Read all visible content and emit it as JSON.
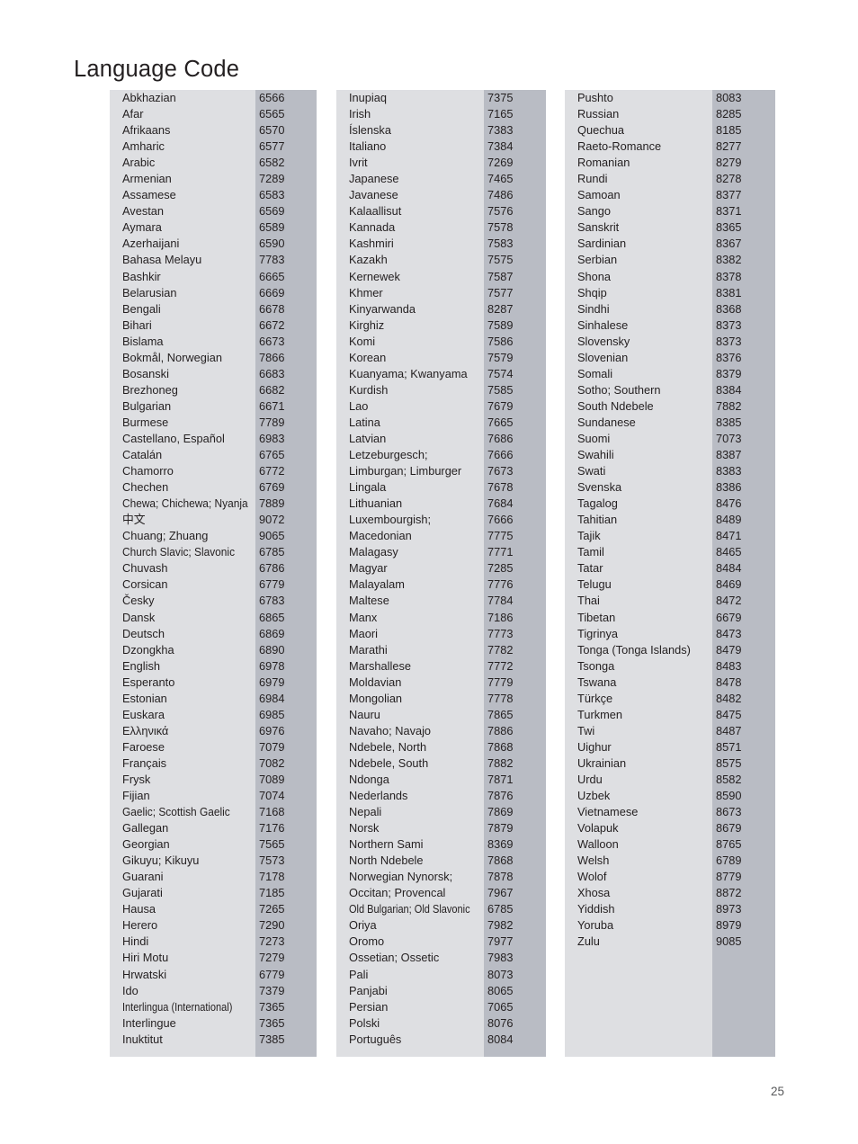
{
  "page": {
    "title": "Language Code",
    "page_number": "25",
    "colors": {
      "name_column_bg": "#dedfe2",
      "code_column_bg": "#b9bcc4",
      "text": "#231f20",
      "page_number_text": "#58595b",
      "background": "#ffffff"
    }
  },
  "columns": [
    {
      "id": "column-1",
      "rows": [
        {
          "name": "Abkhazian",
          "code": "6566"
        },
        {
          "name": "Afar",
          "code": "6565"
        },
        {
          "name": "Afrikaans",
          "code": "6570"
        },
        {
          "name": "Amharic",
          "code": "6577"
        },
        {
          "name": "Arabic",
          "code": "6582"
        },
        {
          "name": "Armenian",
          "code": "7289"
        },
        {
          "name": "Assamese",
          "code": "6583"
        },
        {
          "name": "Avestan",
          "code": "6569"
        },
        {
          "name": "Aymara",
          "code": "6589"
        },
        {
          "name": "Azerhaijani",
          "code": "6590"
        },
        {
          "name": "Bahasa Melayu",
          "code": "7783"
        },
        {
          "name": "Bashkir",
          "code": "6665"
        },
        {
          "name": "Belarusian",
          "code": "6669"
        },
        {
          "name": "Bengali",
          "code": "6678"
        },
        {
          "name": "Bihari",
          "code": "6672"
        },
        {
          "name": "Bislama",
          "code": "6673"
        },
        {
          "name": "Bokmål, Norwegian",
          "code": "7866"
        },
        {
          "name": "Bosanski",
          "code": "6683"
        },
        {
          "name": "Brezhoneg",
          "code": "6682"
        },
        {
          "name": "Bulgarian",
          "code": "6671"
        },
        {
          "name": "Burmese",
          "code": "7789"
        },
        {
          "name": "Castellano, Español",
          "code": "6983"
        },
        {
          "name": "Catalán",
          "code": "6765"
        },
        {
          "name": "Chamorro",
          "code": "6772"
        },
        {
          "name": "Chechen",
          "code": "6769"
        },
        {
          "name": "Chewa; Chichewa; Nyanja",
          "code": "7889"
        },
        {
          "name": "中文",
          "code": "9072"
        },
        {
          "name": "Chuang; Zhuang",
          "code": "9065"
        },
        {
          "name": "Church Slavic; Slavonic",
          "code": "6785"
        },
        {
          "name": "Chuvash",
          "code": "6786"
        },
        {
          "name": "Corsican",
          "code": "6779"
        },
        {
          "name": "Česky",
          "code": "6783"
        },
        {
          "name": "Dansk",
          "code": "6865"
        },
        {
          "name": "Deutsch",
          "code": "6869"
        },
        {
          "name": "Dzongkha",
          "code": "6890"
        },
        {
          "name": "English",
          "code": "6978"
        },
        {
          "name": "Esperanto",
          "code": "6979"
        },
        {
          "name": "Estonian",
          "code": "6984"
        },
        {
          "name": "Euskara",
          "code": "6985"
        },
        {
          "name": "Ελληνικά",
          "code": "6976"
        },
        {
          "name": "Faroese",
          "code": "7079"
        },
        {
          "name": "Français",
          "code": "7082"
        },
        {
          "name": "Frysk",
          "code": "7089"
        },
        {
          "name": "Fijian",
          "code": "7074"
        },
        {
          "name": "Gaelic; Scottish Gaelic",
          "code": "7168"
        },
        {
          "name": "Gallegan",
          "code": "7176"
        },
        {
          "name": "Georgian",
          "code": "7565"
        },
        {
          "name": "Gikuyu; Kikuyu",
          "code": "7573"
        },
        {
          "name": "Guarani",
          "code": "7178"
        },
        {
          "name": "Gujarati",
          "code": "7185"
        },
        {
          "name": "Hausa",
          "code": "7265"
        },
        {
          "name": "Herero",
          "code": "7290"
        },
        {
          "name": "Hindi",
          "code": "7273"
        },
        {
          "name": "Hiri Motu",
          "code": "7279"
        },
        {
          "name": "Hrwatski",
          "code": "6779"
        },
        {
          "name": "Ido",
          "code": "7379"
        },
        {
          "name": "Interlingua (International)",
          "code": "7365"
        },
        {
          "name": "Interlingue",
          "code": "7365"
        },
        {
          "name": "Inuktitut",
          "code": "7385"
        }
      ]
    },
    {
      "id": "column-2",
      "rows": [
        {
          "name": "Inupiaq",
          "code": "7375"
        },
        {
          "name": "Irish",
          "code": "7165"
        },
        {
          "name": "Íslenska",
          "code": "7383"
        },
        {
          "name": "Italiano",
          "code": "7384"
        },
        {
          "name": "Ivrit",
          "code": "7269"
        },
        {
          "name": "Japanese",
          "code": "7465"
        },
        {
          "name": "Javanese",
          "code": "7486"
        },
        {
          "name": "Kalaallisut",
          "code": "7576"
        },
        {
          "name": "Kannada",
          "code": "7578"
        },
        {
          "name": "Kashmiri",
          "code": "7583"
        },
        {
          "name": "Kazakh",
          "code": "7575"
        },
        {
          "name": "Kernewek",
          "code": "7587"
        },
        {
          "name": "Khmer",
          "code": "7577"
        },
        {
          "name": "Kinyarwanda",
          "code": "8287"
        },
        {
          "name": "Kirghiz",
          "code": "7589"
        },
        {
          "name": "Komi",
          "code": "7586"
        },
        {
          "name": "Korean",
          "code": "7579"
        },
        {
          "name": "Kuanyama; Kwanyama",
          "code": "7574"
        },
        {
          "name": "Kurdish",
          "code": "7585"
        },
        {
          "name": "Lao",
          "code": "7679"
        },
        {
          "name": "Latina",
          "code": "7665"
        },
        {
          "name": "Latvian",
          "code": "7686"
        },
        {
          "name": "Letzeburgesch;",
          "code": "7666"
        },
        {
          "name": "Limburgan; Limburger",
          "code": "7673"
        },
        {
          "name": "Lingala",
          "code": "7678"
        },
        {
          "name": "Lithuanian",
          "code": "7684"
        },
        {
          "name": "Luxembourgish;",
          "code": "7666"
        },
        {
          "name": "Macedonian",
          "code": "7775"
        },
        {
          "name": "Malagasy",
          "code": "7771"
        },
        {
          "name": "Magyar",
          "code": "7285"
        },
        {
          "name": "Malayalam",
          "code": "7776"
        },
        {
          "name": "Maltese",
          "code": "7784"
        },
        {
          "name": "Manx",
          "code": "7186"
        },
        {
          "name": "Maori",
          "code": "7773"
        },
        {
          "name": "Marathi",
          "code": "7782"
        },
        {
          "name": "Marshallese",
          "code": "7772"
        },
        {
          "name": "Moldavian",
          "code": "7779"
        },
        {
          "name": "Mongolian",
          "code": "7778"
        },
        {
          "name": "Nauru",
          "code": "7865"
        },
        {
          "name": "Navaho; Navajo",
          "code": "7886"
        },
        {
          "name": "Ndebele, North",
          "code": "7868"
        },
        {
          "name": "Ndebele, South",
          "code": "7882"
        },
        {
          "name": "Ndonga",
          "code": "7871"
        },
        {
          "name": "Nederlands",
          "code": "7876"
        },
        {
          "name": "Nepali",
          "code": "7869"
        },
        {
          "name": "Norsk",
          "code": "7879"
        },
        {
          "name": "Northern Sami",
          "code": "8369"
        },
        {
          "name": "North Ndebele",
          "code": "7868"
        },
        {
          "name": "Norwegian Nynorsk;",
          "code": "7878"
        },
        {
          "name": "Occitan; Provencal",
          "code": "7967"
        },
        {
          "name": "Old Bulgarian; Old Slavonic",
          "code": "6785"
        },
        {
          "name": "Oriya",
          "code": "7982"
        },
        {
          "name": "Oromo",
          "code": "7977"
        },
        {
          "name": "Ossetian; Ossetic",
          "code": "7983"
        },
        {
          "name": "Pali",
          "code": "8073"
        },
        {
          "name": "Panjabi",
          "code": "8065"
        },
        {
          "name": "Persian",
          "code": "7065"
        },
        {
          "name": "Polski",
          "code": "8076"
        },
        {
          "name": "Português",
          "code": "8084"
        }
      ]
    },
    {
      "id": "column-3",
      "rows": [
        {
          "name": "Pushto",
          "code": "8083"
        },
        {
          "name": "Russian",
          "code": "8285"
        },
        {
          "name": "Quechua",
          "code": "8185"
        },
        {
          "name": "Raeto-Romance",
          "code": "8277"
        },
        {
          "name": "Romanian",
          "code": "8279"
        },
        {
          "name": "Rundi",
          "code": "8278"
        },
        {
          "name": "Samoan",
          "code": "8377"
        },
        {
          "name": "Sango",
          "code": "8371"
        },
        {
          "name": "Sanskrit",
          "code": "8365"
        },
        {
          "name": "Sardinian",
          "code": "8367"
        },
        {
          "name": "Serbian",
          "code": "8382"
        },
        {
          "name": "Shona",
          "code": "8378"
        },
        {
          "name": "Shqip",
          "code": "8381"
        },
        {
          "name": "Sindhi",
          "code": "8368"
        },
        {
          "name": "Sinhalese",
          "code": "8373"
        },
        {
          "name": "Slovensky",
          "code": "8373"
        },
        {
          "name": "Slovenian",
          "code": "8376"
        },
        {
          "name": "Somali",
          "code": "8379"
        },
        {
          "name": "Sotho; Southern",
          "code": "8384"
        },
        {
          "name": "South Ndebele",
          "code": "7882"
        },
        {
          "name": "Sundanese",
          "code": "8385"
        },
        {
          "name": "Suomi",
          "code": "7073"
        },
        {
          "name": "Swahili",
          "code": "8387"
        },
        {
          "name": "Swati",
          "code": "8383"
        },
        {
          "name": "Svenska",
          "code": "8386"
        },
        {
          "name": "Tagalog",
          "code": "8476"
        },
        {
          "name": "Tahitian",
          "code": "8489"
        },
        {
          "name": "Tajik",
          "code": "8471"
        },
        {
          "name": "Tamil",
          "code": "8465"
        },
        {
          "name": "Tatar",
          "code": "8484"
        },
        {
          "name": "Telugu",
          "code": "8469"
        },
        {
          "name": "Thai",
          "code": "8472"
        },
        {
          "name": "Tibetan",
          "code": "6679"
        },
        {
          "name": "Tigrinya",
          "code": "8473"
        },
        {
          "name": "Tonga (Tonga Islands)",
          "code": "8479"
        },
        {
          "name": "Tsonga",
          "code": "8483"
        },
        {
          "name": "Tswana",
          "code": "8478"
        },
        {
          "name": "Türkçe",
          "code": "8482"
        },
        {
          "name": "Turkmen",
          "code": "8475"
        },
        {
          "name": "Twi",
          "code": "8487"
        },
        {
          "name": "Uighur",
          "code": "8571"
        },
        {
          "name": "Ukrainian",
          "code": "8575"
        },
        {
          "name": "Urdu",
          "code": "8582"
        },
        {
          "name": "Uzbek",
          "code": "8590"
        },
        {
          "name": "Vietnamese",
          "code": "8673"
        },
        {
          "name": "Volapuk",
          "code": "8679"
        },
        {
          "name": "Walloon",
          "code": "8765"
        },
        {
          "name": "Welsh",
          "code": "6789"
        },
        {
          "name": "Wolof",
          "code": "8779"
        },
        {
          "name": "Xhosa",
          "code": "8872"
        },
        {
          "name": "Yiddish",
          "code": "8973"
        },
        {
          "name": "Yoruba",
          "code": "8979"
        },
        {
          "name": "Zulu",
          "code": "9085"
        }
      ]
    }
  ]
}
